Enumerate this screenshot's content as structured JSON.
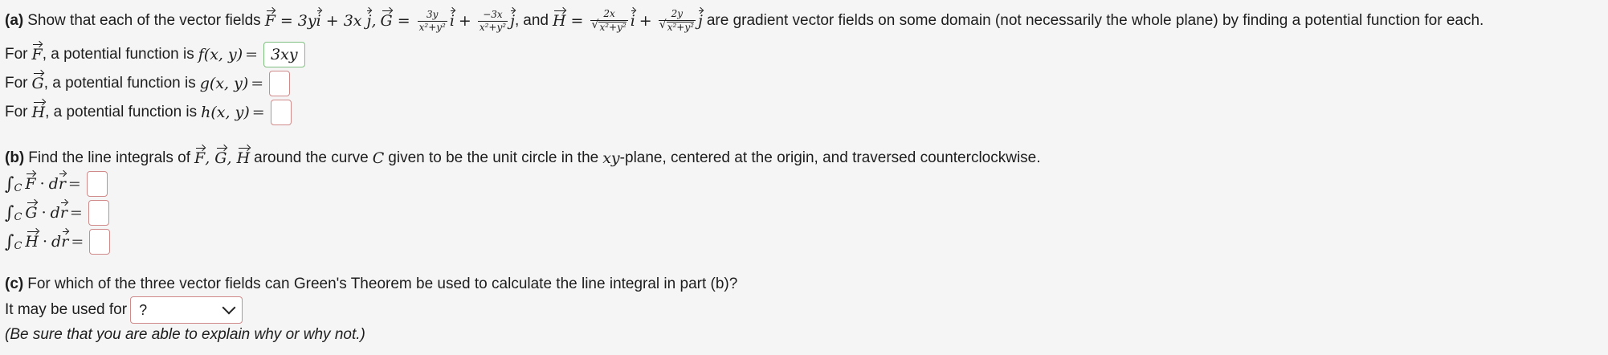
{
  "part_a": {
    "label": "(a)",
    "prompt_start": "Show that each of the vector fields",
    "F_def": "= 3y i + 3x j,",
    "G_num1": "3y",
    "G_den1": "x²+y²",
    "G_num2": "−3x",
    "G_den2": "x²+y²",
    "and": "and",
    "H_num1": "2x",
    "H_den1": "x²+y²",
    "H_num2": "2y",
    "H_den2": "x²+y²",
    "prompt_end": "are gradient vector fields on some domain (not necessarily the whole plane) by finding a potential function for each.",
    "row_f_prefix": "For",
    "row_f_mid": ", a potential function is",
    "row_f_func": "f(x, y)",
    "row_f_answer": "3xy",
    "row_g_prefix": "For",
    "row_g_mid": ", a potential function is",
    "row_g_func": "g(x, y)",
    "row_g_answer": "",
    "row_h_prefix": "For",
    "row_h_mid": ", a potential function is",
    "row_h_func": "h(x, y)",
    "row_h_answer": ""
  },
  "part_b": {
    "label": "(b)",
    "prompt_start": "Find the line integrals of",
    "prompt_mid": "around the curve",
    "curve": "C",
    "prompt_mid2": "given to be the unit circle in the",
    "plane": "xy",
    "prompt_end": "-plane, centered at the origin, and traversed counterclockwise.",
    "sub": "C",
    "dr": "dr",
    "answer_F": "",
    "answer_G": "",
    "answer_H": ""
  },
  "part_c": {
    "label": "(c)",
    "prompt": "For which of the three vector fields can Green's Theorem be used to calculate the line integral in part (b)?",
    "select_label": "It may be used for",
    "select_value": "?",
    "note": "(Be sure that you are able to explain why or why not.)"
  },
  "colors": {
    "correct_border": "#7fbf7f",
    "empty_border": "#d08a8a",
    "background": "#f5f5f5"
  }
}
